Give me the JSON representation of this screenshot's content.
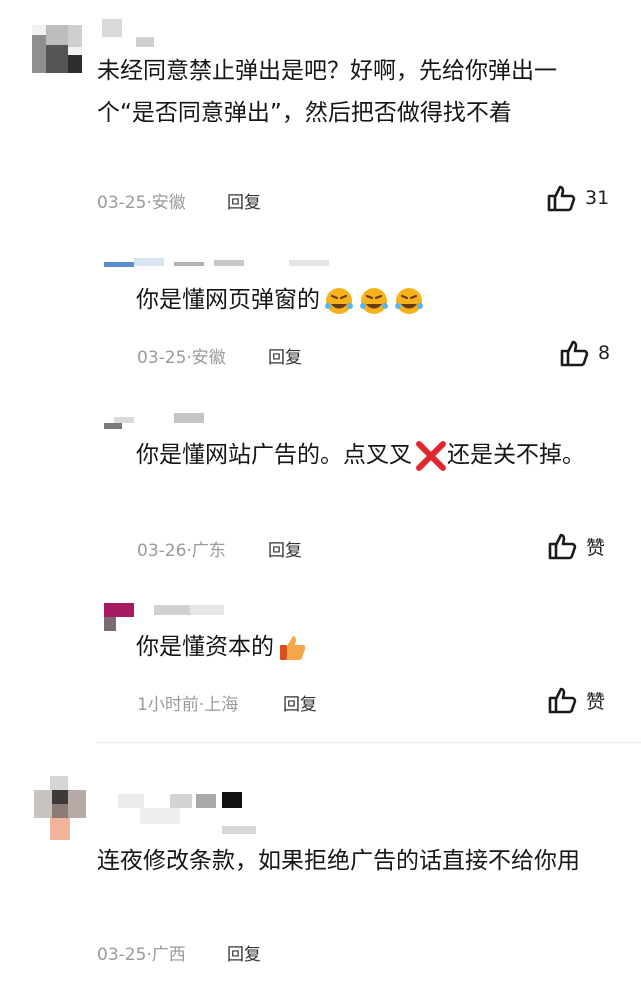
{
  "comments": [
    {
      "text": "未经同意禁止弹出是吧？好啊，先给你弹出一个“是否同意弹出”，然后把否做得找不着",
      "date": "03-25·安徽",
      "reply_label": "回复",
      "likes": "31",
      "replies": [
        {
          "text": "你是懂网页弹窗的",
          "date": "03-25·安徽",
          "reply_label": "回复",
          "likes": "8"
        },
        {
          "text_a": "你是懂网站广告的。点叉叉",
          "text_b": "还是关不掉。",
          "date": "03-26·广东",
          "reply_label": "回复",
          "likes": "赞"
        },
        {
          "text": "你是懂资本的",
          "date": "1小时前·上海",
          "reply_label": "回复",
          "likes": "赞"
        }
      ]
    },
    {
      "text": "连夜修改条款，如果拒绝广告的话直接不给你用",
      "date": "03-25·广西",
      "reply_label": "回复"
    }
  ],
  "icons": {
    "like": "thumbs-up-outline-icon",
    "laugh_emoji": "rolling-laughing-emoji",
    "cross_emoji": "red-cross-mark-emoji",
    "thumbs_emoji": "thumbs-up-emoji"
  },
  "colors": {
    "text": "#161616",
    "meta": "#9a9a9a",
    "cross": "#e0282e",
    "emoji_yellow": "#f6b21c"
  }
}
